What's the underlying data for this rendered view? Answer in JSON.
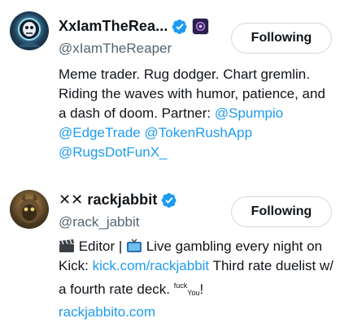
{
  "accounts": [
    {
      "name": "XxIamTheRea...",
      "handle": "@xIamTheReaper",
      "follow_label": "Following",
      "bio_text": "Meme trader. Rug dodger. Chart gremlin. Riding the waves with humor, patience, and a dash of doom. Partner: ",
      "mentions": [
        "@Spumpio",
        "@EdgeTrade",
        "@TokenRushApp",
        "@RugsDotFunX_"
      ]
    },
    {
      "name_prefix": "✕✕",
      "name": "rackjabbit",
      "handle": "@rack_jabbit",
      "follow_label": "Following",
      "bio_part1": " Editor | ",
      "bio_part2": " Live gambling every night on Kick: ",
      "bio_link": "kick.com/rackjabbit",
      "bio_part3": " Third rate duelist w/ a fourth rate deck. ",
      "bio_sup": "fuck",
      "bio_sub": "You",
      "bio_end": "!",
      "website": "rackjabbito.com"
    }
  ],
  "colors": {
    "link": "#1d9bf0",
    "verified": "#1d9bf0",
    "text": "#0f1419",
    "muted": "#536471"
  },
  "icons": {
    "verified": "verified-badge-icon",
    "affiliate": "affiliate-badge-icon",
    "clapper": "clapper-board-emoji",
    "tv": "television-emoji"
  }
}
